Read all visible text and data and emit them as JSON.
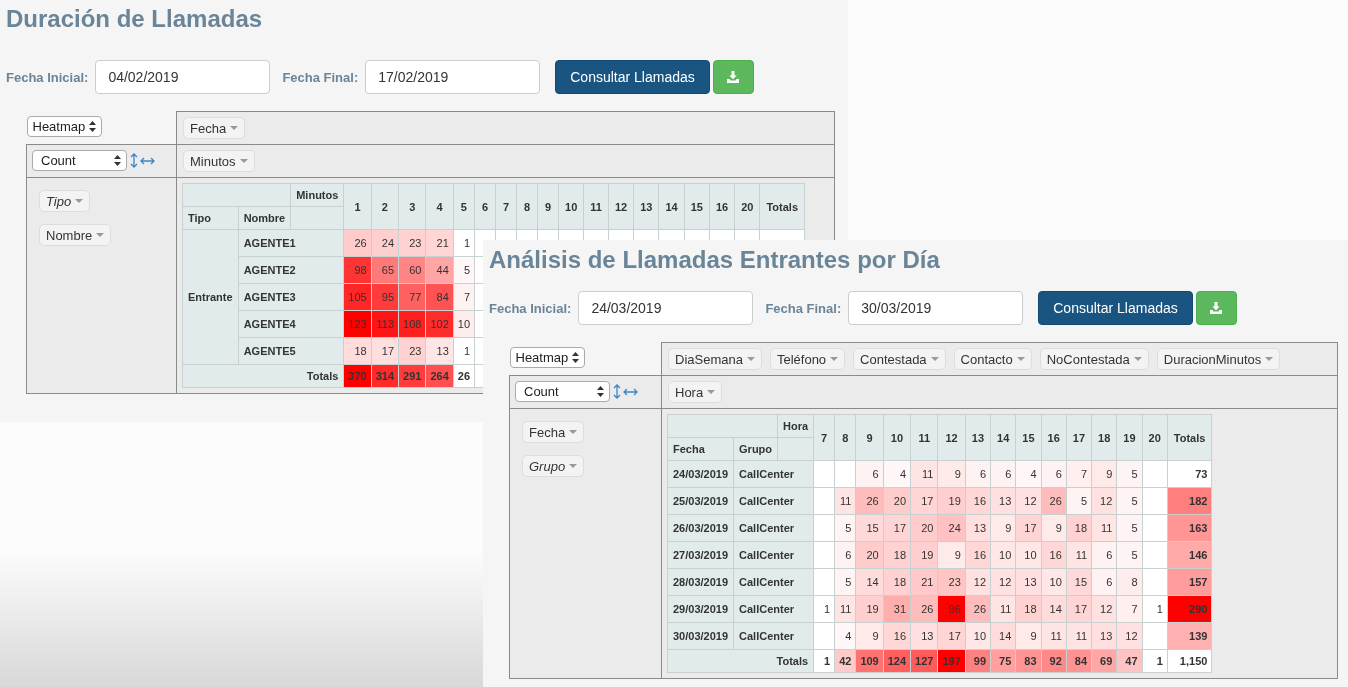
{
  "reports": [
    {
      "title": "Duración de Llamadas",
      "filters": [
        {
          "label": "Fecha Inicial:",
          "value": "04/02/2019"
        },
        {
          "label": "Fecha Final:",
          "value": "17/02/2019"
        }
      ],
      "submit_label": "Consultar Llamadas",
      "pivot": {
        "renderer": "Heatmap",
        "aggregator": "Count",
        "unused_fields": [
          {
            "label": "Fecha",
            "filtered": false
          }
        ],
        "column_fields": [
          {
            "label": "Minutos",
            "filtered": false
          }
        ],
        "row_fields": [
          {
            "label": "Tipo",
            "filtered": true
          },
          {
            "label": "Nombre",
            "filtered": false
          }
        ],
        "table": {
          "column_axis": "Minutos",
          "row_axes": [
            "Tipo",
            "Nombre"
          ],
          "columns": [
            "1",
            "2",
            "3",
            "4",
            "5",
            "6",
            "7",
            "8",
            "9",
            "10",
            "11",
            "12",
            "13",
            "14",
            "15",
            "16",
            "20"
          ],
          "totals_header": "Totals",
          "groups": [
            {
              "label": "Entrante",
              "rows": [
                {
                  "label": "AGENTE1",
                  "cells": [
                    "26",
                    "24",
                    "23",
                    "21",
                    "1"
                  ]
                },
                {
                  "label": "AGENTE2",
                  "cells": [
                    "98",
                    "65",
                    "60",
                    "44",
                    "5"
                  ]
                },
                {
                  "label": "AGENTE3",
                  "cells": [
                    "105",
                    "95",
                    "77",
                    "84",
                    "7"
                  ]
                },
                {
                  "label": "AGENTE4",
                  "cells": [
                    "123",
                    "113",
                    "108",
                    "102",
                    "10"
                  ]
                },
                {
                  "label": "AGENTE5",
                  "cells": [
                    "18",
                    "17",
                    "23",
                    "13",
                    "1"
                  ]
                }
              ]
            }
          ],
          "totals": {
            "label": "Totals",
            "cells": [
              "370",
              "314",
              "291",
              "264",
              "26"
            ]
          }
        }
      }
    },
    {
      "title": "Análisis de Llamadas Entrantes por Día",
      "filters": [
        {
          "label": "Fecha Inicial:",
          "value": "24/03/2019"
        },
        {
          "label": "Fecha Final:",
          "value": "30/03/2019"
        }
      ],
      "submit_label": "Consultar Llamadas",
      "pivot": {
        "renderer": "Heatmap",
        "aggregator": "Count",
        "unused_fields": [
          {
            "label": "DiaSemana",
            "filtered": false
          },
          {
            "label": "Teléfono",
            "filtered": false
          },
          {
            "label": "Contestada",
            "filtered": false
          },
          {
            "label": "Contacto",
            "filtered": false
          },
          {
            "label": "NoContestada",
            "filtered": false
          },
          {
            "label": "DuracionMinutos",
            "filtered": false
          }
        ],
        "column_fields": [
          {
            "label": "Hora",
            "filtered": false
          }
        ],
        "row_fields": [
          {
            "label": "Fecha",
            "filtered": false
          },
          {
            "label": "Grupo",
            "filtered": true
          }
        ],
        "table": {
          "column_axis": "Hora",
          "row_axes": [
            "Fecha",
            "Grupo"
          ],
          "columns": [
            "7",
            "8",
            "9",
            "10",
            "11",
            "12",
            "13",
            "14",
            "15",
            "16",
            "17",
            "18",
            "19",
            "20"
          ],
          "totals_header": "Totals",
          "groups": [
            {
              "label": "24/03/2019",
              "rows": [
                {
                  "label": "CallCenter",
                  "cells": [
                    null,
                    null,
                    "6",
                    "4",
                    "11",
                    "9",
                    "6",
                    "6",
                    "4",
                    "6",
                    "7",
                    "9",
                    "5",
                    null
                  ],
                  "total": "73"
                }
              ]
            },
            {
              "label": "25/03/2019",
              "rows": [
                {
                  "label": "CallCenter",
                  "cells": [
                    null,
                    "11",
                    "26",
                    "20",
                    "17",
                    "19",
                    "16",
                    "13",
                    "12",
                    "26",
                    "5",
                    "12",
                    "5",
                    null
                  ],
                  "total": "182"
                }
              ]
            },
            {
              "label": "26/03/2019",
              "rows": [
                {
                  "label": "CallCenter",
                  "cells": [
                    null,
                    "5",
                    "15",
                    "17",
                    "20",
                    "24",
                    "13",
                    "9",
                    "17",
                    "9",
                    "18",
                    "11",
                    "5",
                    null
                  ],
                  "total": "163"
                }
              ]
            },
            {
              "label": "27/03/2019",
              "rows": [
                {
                  "label": "CallCenter",
                  "cells": [
                    null,
                    "6",
                    "20",
                    "18",
                    "19",
                    "9",
                    "16",
                    "10",
                    "10",
                    "16",
                    "11",
                    "6",
                    "5",
                    null
                  ],
                  "total": "146"
                }
              ]
            },
            {
              "label": "28/03/2019",
              "rows": [
                {
                  "label": "CallCenter",
                  "cells": [
                    null,
                    "5",
                    "14",
                    "18",
                    "21",
                    "23",
                    "12",
                    "12",
                    "13",
                    "10",
                    "15",
                    "6",
                    "8",
                    null
                  ],
                  "total": "157"
                }
              ]
            },
            {
              "label": "29/03/2019",
              "rows": [
                {
                  "label": "CallCenter",
                  "cells": [
                    "1",
                    "11",
                    "19",
                    "31",
                    "26",
                    "96",
                    "26",
                    "11",
                    "18",
                    "14",
                    "17",
                    "12",
                    "7",
                    "1"
                  ],
                  "total": "290"
                }
              ]
            },
            {
              "label": "30/03/2019",
              "rows": [
                {
                  "label": "CallCenter",
                  "cells": [
                    null,
                    "4",
                    "9",
                    "16",
                    "13",
                    "17",
                    "10",
                    "14",
                    "9",
                    "11",
                    "11",
                    "13",
                    "12",
                    null
                  ],
                  "total": "139"
                }
              ]
            }
          ],
          "totals": {
            "label": "Totals",
            "cells": [
              "1",
              "42",
              "109",
              "124",
              "127",
              "197",
              "99",
              "75",
              "83",
              "92",
              "84",
              "69",
              "47",
              "1"
            ],
            "grand": "1,150"
          }
        }
      }
    }
  ]
}
